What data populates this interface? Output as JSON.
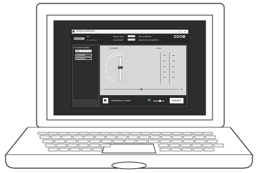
{
  "window": {
    "title": "ZOOM GUIDE Mixer",
    "controls": "– □ ×"
  },
  "header": {
    "device_name": "H1",
    "device_status": "Connected",
    "mode_label": "Mixing Type",
    "low_rolloff_label": "Low Rolloff",
    "sd_label": "SD Card",
    "sd_value": "8 GB",
    "recording_time_label": "Recording Time",
    "recording_time_value": "00:00",
    "logo": "ZOOM"
  },
  "sidebar": {
    "heading": "FILE BROWSER",
    "items": [
      {
        "label": "ALL",
        "active": true
      },
      {
        "label": "FOLDER01",
        "active": false
      },
      {
        "label": "FOLDER02",
        "active": false
      }
    ]
  },
  "mixer": {
    "stereo_label": "STEREO",
    "gain_label": "GAIN",
    "balance_left": "L",
    "balance_right": "R"
  },
  "player": {
    "play_icon": "play-icon",
    "file_name": "ZOOM0001_XY.WAV",
    "volume_icon": "speaker-icon",
    "export_label": "EXPORT"
  }
}
